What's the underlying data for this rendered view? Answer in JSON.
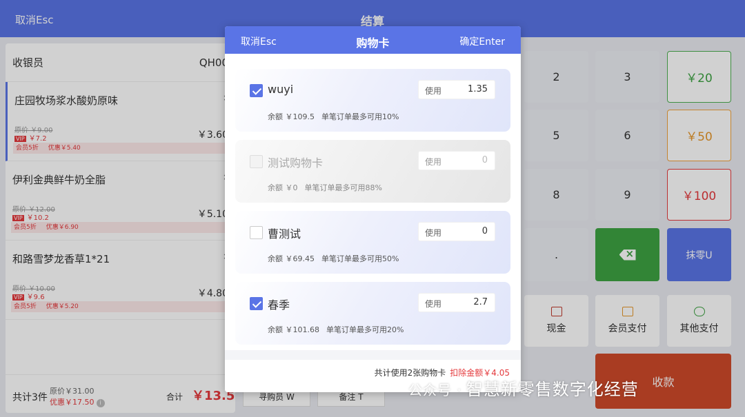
{
  "topbar": {
    "cancel": "取消Esc",
    "title": "结算"
  },
  "left": {
    "cashier_label": "收银员",
    "cashier_id": "QH00",
    "items": [
      {
        "name": "庄园牧场浆水酸奶原味",
        "x": "×",
        "orig": "原价 ￥9.00",
        "vip_tag": "VIP",
        "vip_price": "￥7.2",
        "price": "￥3.60",
        "promo1": "会员5折",
        "promo2": "优惠￥5.40"
      },
      {
        "name": "伊利金典鲜牛奶全脂",
        "x": "×",
        "orig": "原价 ￥12.00",
        "vip_tag": "VIP",
        "vip_price": "￥10.2",
        "price": "￥5.10",
        "promo1": "会员5折",
        "promo2": "优惠￥6.90"
      },
      {
        "name": "和路雪梦龙香草1*21",
        "x": "×",
        "orig": "原价 ￥10.00",
        "vip_tag": "VIP",
        "vip_price": "￥9.6",
        "price": "￥4.80",
        "promo1": "会员5折",
        "promo2": "优惠￥5.20"
      }
    ],
    "count": "共计3件",
    "orig_total": "原价￥31.00",
    "discount_total": "优惠￥17.50",
    "info": "i",
    "total_label": "合计",
    "total": "￥13.50"
  },
  "keypad": {
    "k2": "2",
    "k3": "3",
    "k5": "5",
    "k6": "6",
    "k8": "8",
    "k9": "9",
    "dot": ".",
    "q20": "￥20",
    "q50": "￥50",
    "q100": "￥100",
    "round": "抹零U",
    "cash": "现金",
    "member_pay": "会员支付",
    "other_pay": "其他支付",
    "collect": "收款"
  },
  "behind": {
    "b1": "寻购员 W",
    "b2": "备注 T"
  },
  "modal": {
    "cancel": "取消Esc",
    "title": "购物卡",
    "confirm": "确定Enter",
    "cards": [
      {
        "name": "wuyi",
        "use_label": "使用",
        "use_value": "1.35",
        "balance": "余额 ￥109.5",
        "limit": "单笔订单最多可用10%",
        "checked": true,
        "disabled": false
      },
      {
        "name": "测试购物卡",
        "use_label": "使用",
        "use_value": "0",
        "balance": "余额 ￥0",
        "limit": "单笔订单最多可用88%",
        "checked": false,
        "disabled": true
      },
      {
        "name": "曹测试",
        "use_label": "使用",
        "use_value": "0",
        "balance": "余额 ￥69.45",
        "limit": "单笔订单最多可用50%",
        "checked": false,
        "disabled": false
      },
      {
        "name": "春季",
        "use_label": "使用",
        "use_value": "2.7",
        "balance": "余额 ￥101.68",
        "limit": "单笔订单最多可用20%",
        "checked": true,
        "disabled": false
      }
    ],
    "summary": "共计使用2张购物卡",
    "deduct": "扣除金额￥4.05"
  },
  "watermark": {
    "prefix": "公众号 ·",
    "text": "智慧新零售数字化经营"
  },
  "colors": {
    "accent": "#5a74e6",
    "red": "#e4393c",
    "green": "#3ea343",
    "orange": "#e6962a"
  }
}
